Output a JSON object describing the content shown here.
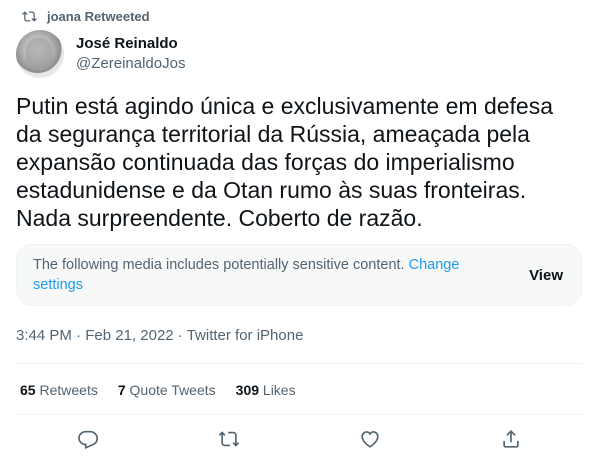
{
  "retweet": {
    "label": "joana Retweeted",
    "icon": "retweet-icon"
  },
  "author": {
    "name": "José Reinaldo",
    "handle": "@ZereinaldoJos"
  },
  "tweet": {
    "text": "Putin está agindo única e exclusivamente em defesa da segurança territorial da Rússia, ameaçada pela expansão continuada das forças do imperialismo estadunidense e da Otan rumo às suas fronteiras. Nada surpreendente. Coberto de razão."
  },
  "sensitive": {
    "message": "The following media includes potentially sensitive content.",
    "link": "Change settings",
    "view_label": "View"
  },
  "meta": {
    "time": "3:44 PM",
    "date": "Feb 21, 2022",
    "source": "Twitter for iPhone",
    "separator": "·"
  },
  "stats": {
    "retweets_count": "65",
    "retweets_label": "Retweets",
    "quotes_count": "7",
    "quotes_label": "Quote Tweets",
    "likes_count": "309",
    "likes_label": "Likes"
  },
  "actions": [
    "reply-icon",
    "retweet-icon",
    "like-icon",
    "share-icon"
  ],
  "colors": {
    "link": "#1d9bf0",
    "secondary_text": "#536471",
    "primary_text": "#0f1419"
  }
}
